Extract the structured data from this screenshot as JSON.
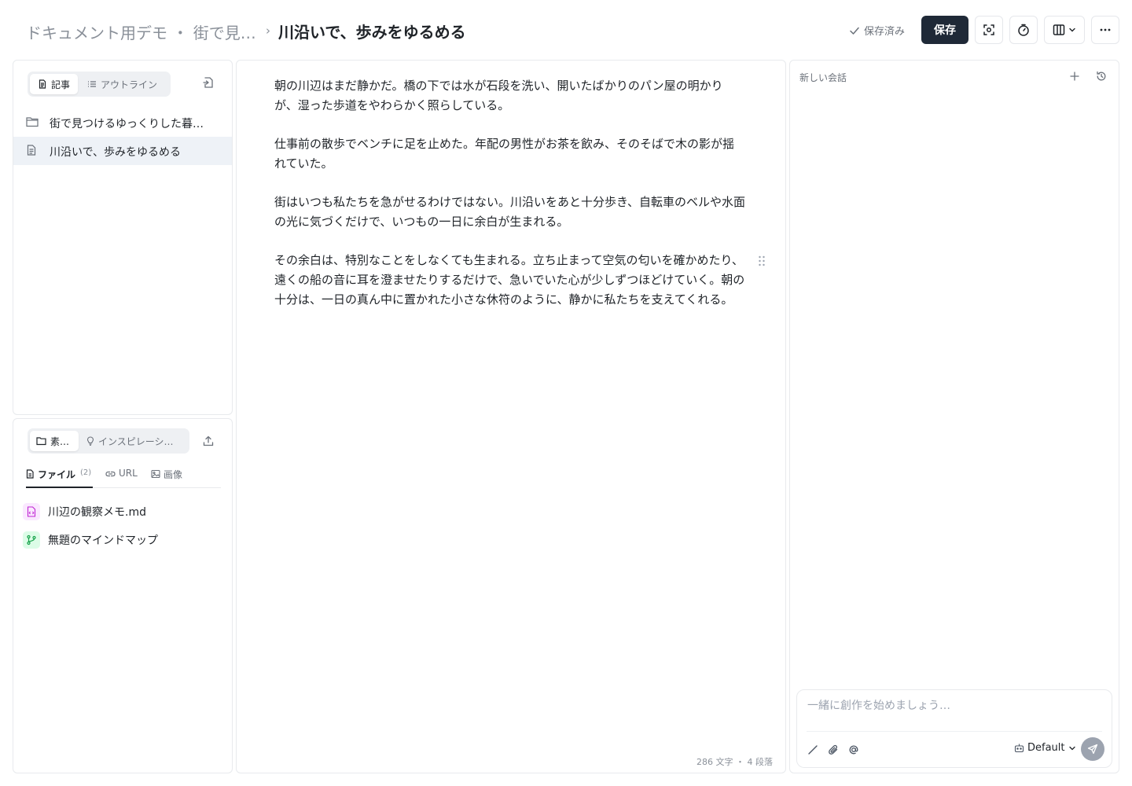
{
  "header": {
    "breadcrumb_parent": "ドキュメント用デモ ・ 街で見…",
    "breadcrumb_separator": "›",
    "title": "川沿いで、歩みをゆるめる",
    "saved_status": "保存済み",
    "save_label": "保存",
    "icons": [
      "check-icon",
      "focus-icon",
      "timer-icon",
      "columns-icon",
      "chevron-down-icon",
      "more-icon"
    ]
  },
  "article_panel": {
    "tabs": [
      {
        "label": "記事",
        "icon": "document-icon",
        "active": true
      },
      {
        "label": "アウトライン",
        "icon": "list-icon",
        "active": false
      }
    ],
    "tree": [
      {
        "label": "街で見つけるゆっくりした暮…",
        "icon": "folder-icon",
        "selected": false
      },
      {
        "label": "川沿いで、歩みをゆるめる",
        "icon": "document-icon",
        "selected": true
      }
    ]
  },
  "material_panel": {
    "tabs": [
      {
        "label": "素…",
        "icon": "folder-icon",
        "active": true
      },
      {
        "label": "インスピレーシ…",
        "icon": "bulb-icon",
        "active": false
      }
    ],
    "subtabs": [
      {
        "label": "ファイル",
        "count": "(2)",
        "icon": "file-icon",
        "active": true
      },
      {
        "label": "URL",
        "count": "",
        "icon": "link-icon",
        "active": false
      },
      {
        "label": "画像",
        "count": "",
        "icon": "image-icon",
        "active": false
      }
    ],
    "files": [
      {
        "name": "川辺の観察メモ.md",
        "icon": "markdown-file-icon",
        "color": "#c026d3",
        "bg": "#fae8ff"
      },
      {
        "name": "無題のマインドマップ",
        "icon": "mindmap-icon",
        "color": "#16a34a",
        "bg": "#dcfce7"
      }
    ]
  },
  "editor": {
    "paragraphs": [
      "朝の川辺はまだ静かだ。橋の下では水が石段を洗い、開いたばかりのパン屋の明かりが、湿った歩道をやわらかく照らしている。",
      "仕事前の散歩でベンチに足を止めた。年配の男性がお茶を飲み、そのそばで木の影が揺れていた。",
      "街はいつも私たちを急がせるわけではない。川沿いをあと十分歩き、自転車のベルや水面の光に気づくだけで、いつもの一日に余白が生まれる。",
      "その余白は、特別なことをしなくても生まれる。立ち止まって空気の匂いを確かめたり、遠くの船の音に耳を澄ませたりするだけで、急いでいた心が少しずつほどけていく。朝の十分は、一日の真ん中に置かれた小さな休符のように、静かに私たちを支えてくれる。"
    ],
    "status": "286 文字 ・ 4 段落"
  },
  "chat": {
    "title": "新しい会話",
    "input_placeholder": "一緒に創作を始めましょう…",
    "model": "Default"
  },
  "colors": {
    "primary_button": "#1f2937",
    "selected_row": "#eef2f7",
    "border": "#e8eaed"
  }
}
